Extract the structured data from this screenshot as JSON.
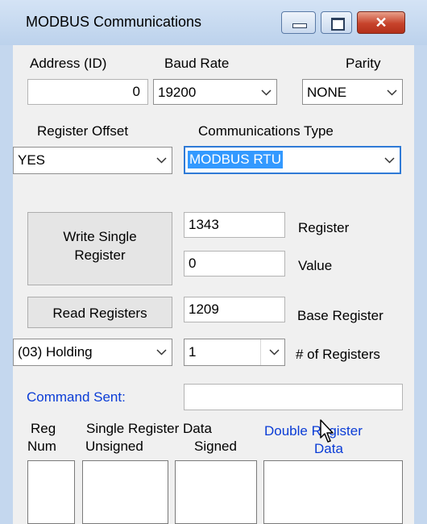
{
  "window": {
    "title": "MODBUS Communications",
    "close_glyph": "✕"
  },
  "connection": {
    "address_label": "Address (ID)",
    "address_value": "0",
    "baud_label": "Baud Rate",
    "baud_value": "19200",
    "parity_label": "Parity",
    "parity_value": "NONE",
    "offset_label": "Register Offset",
    "offset_value": "YES",
    "comm_type_label": "Communications Type",
    "comm_type_value": "MODBUS RTU"
  },
  "write": {
    "button_label_line1": "Write Single",
    "button_label_line2": "Register",
    "register_value": "1343",
    "register_label": "Register",
    "value_value": "0",
    "value_label": "Value"
  },
  "read": {
    "button_label": "Read Registers",
    "base_register_value": "1209",
    "base_register_label": "Base Register",
    "function_value": "(03) Holding",
    "count_value": "1",
    "count_label": "# of Registers"
  },
  "command": {
    "label": "Command Sent:",
    "value": ""
  },
  "columns": {
    "reg_line1": "Reg",
    "reg_line2": "Num",
    "single_header": "Single Register Data",
    "unsigned_header": "Unsigned",
    "signed_header": "Signed",
    "double_line1": "Double Register",
    "double_line2": "Data"
  },
  "colors": {
    "accent_blue": "#0a3cd6",
    "selection": "#3399ff",
    "frame": "#c4d7ee",
    "close_red": "#c7432b"
  },
  "icons": [
    "minimize-icon",
    "maximize-icon",
    "close-icon",
    "chevron-down-icon",
    "mouse-cursor-icon"
  ]
}
